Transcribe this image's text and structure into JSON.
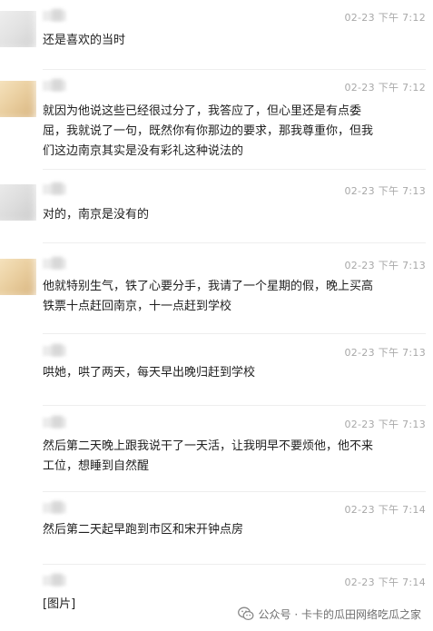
{
  "messages": [
    {
      "id": 1,
      "time": "02-23 下午 7:12",
      "text": "还是喜欢的当时",
      "avatar_colors": [
        "#f2f2f2",
        "#d9d9d9"
      ]
    },
    {
      "id": 2,
      "time": "02-23 下午 7:12",
      "text": "就因为他说这些已经很过分了，我答应了，但心里还是有点委\n屈，我就说了一句，既然你有你那边的要求，那我尊重你，但我\n们这边南京其实是没有彩礼这种说法的",
      "avatar_colors": [
        "#f6e6c8",
        "#d9b98a"
      ]
    },
    {
      "id": 3,
      "time": "02-23 下午 7:13",
      "text": "对的，南京是没有的",
      "avatar_colors": [
        "#efefef",
        "#d4d4d4"
      ]
    },
    {
      "id": 4,
      "time": "02-23 下午 7:13",
      "text": "他就特别生气，铁了心要分手，我请了一个星期的假，晚上买高\n铁票十点赶回南京，十一点赶到学校",
      "avatar_colors": [
        "#f6e6c8",
        "#d9b98a"
      ]
    },
    {
      "id": 5,
      "time": "02-23 下午 7:13",
      "text": "哄她，哄了两天，每天早出晚归赶到学校",
      "avatar_colors": [
        "#ffffff",
        "#ffffff"
      ]
    },
    {
      "id": 6,
      "time": "02-23 下午 7:13",
      "text": "然后第二天晚上跟我说干了一天活，让我明早不要烦他，他不来\n工位，想睡到自然醒",
      "avatar_colors": [
        "#ffffff",
        "#ffffff"
      ]
    },
    {
      "id": 7,
      "time": "02-23 下午 7:14",
      "text": "然后第二天起早跑到市区和宋开钟点房",
      "avatar_colors": [
        "#ffffff",
        "#ffffff"
      ]
    },
    {
      "id": 8,
      "time": "02-23 下午 7:14",
      "text": "[图片]",
      "avatar_colors": [
        "#ffffff",
        "#ffffff"
      ]
    }
  ],
  "watermark": {
    "text": "公众号 · 卡卡的瓜田网络吃瓜之家",
    "icon": "wechat-official-account-icon"
  }
}
